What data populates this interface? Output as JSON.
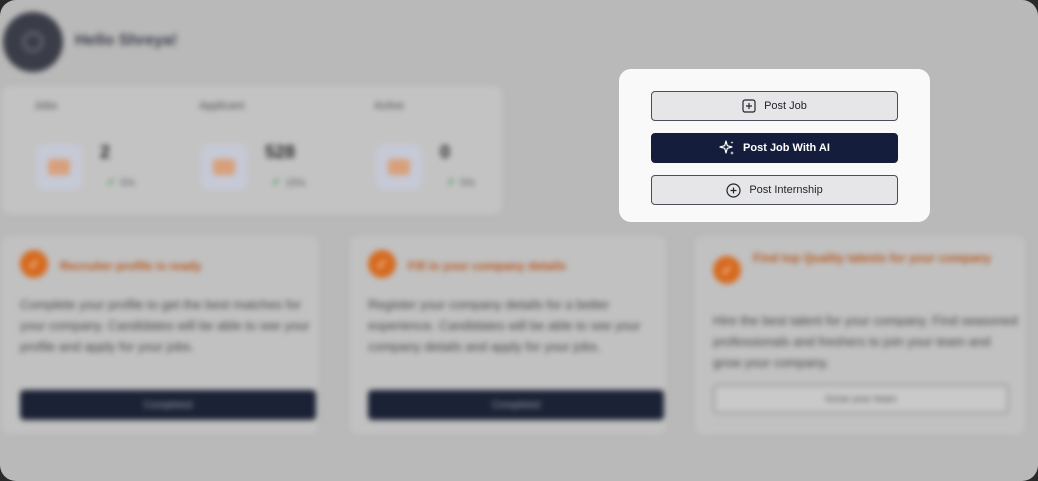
{
  "header": {
    "greeting": "Hello Shreya!"
  },
  "stats": [
    {
      "label": "Jobs",
      "value": "2",
      "trend": "5%"
    },
    {
      "label": "Applicant",
      "value": "528",
      "trend": "15%"
    },
    {
      "label": "Active",
      "value": "0",
      "trend": "5%"
    }
  ],
  "cards": [
    {
      "title": "Recruiter profile is ready",
      "body": "Complete your profile to get the best matches for your company. Candidates will be able to see your profile and apply for your jobs.",
      "button": "Completed"
    },
    {
      "title": "Fill in your company details",
      "body": "Register your company details for a better experience. Candidates will be able to see your company details and apply for your jobs.",
      "button": "Completed"
    },
    {
      "title": "Find top Quality talents for your company",
      "body": "Hire the best talent for your company. Find seasoned professionals and freshers to join your team and grow your company.",
      "button": "Grow your team"
    }
  ],
  "popup": {
    "post_job": "Post Job",
    "post_job_ai": "Post Job With AI",
    "post_internship": "Post Internship"
  },
  "icons": {
    "post_job": "plus-square-icon",
    "post_job_ai": "sparkle-icon",
    "post_internship": "plus-circle-icon",
    "card_badge": "check-icon"
  },
  "colors": {
    "accent": "#141e3c",
    "orange": "#d66a1f"
  }
}
